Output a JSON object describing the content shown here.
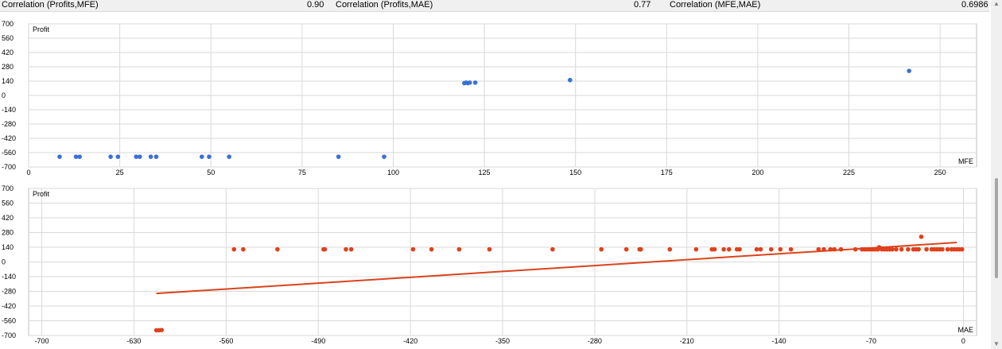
{
  "correlations": [
    {
      "label": "Correlation (Profits,MFE)",
      "value": "0.90"
    },
    {
      "label": "Correlation (Profits,MAE)",
      "value": "0.77"
    },
    {
      "label": "Correlation (MFE,MAE)",
      "value": "0.6986"
    }
  ],
  "scrollbar": {
    "up_icon": "triangle-up",
    "down_icon": "triangle-down"
  },
  "colors": {
    "mfe_points": "#3a6fd8",
    "mae_points": "#e0401a",
    "trend_line": "#d9441c",
    "grid": "#d9d9d9"
  },
  "chart_data": [
    {
      "type": "scatter",
      "ylabel": "Profit",
      "xlabel": "MFE",
      "ylim": [
        -700,
        700
      ],
      "xlim": [
        0,
        260
      ],
      "y_ticks": [
        700,
        560,
        420,
        280,
        140,
        0,
        -140,
        -280,
        -420,
        -560,
        -700
      ],
      "x_ticks": [
        0,
        25,
        50,
        75,
        100,
        125,
        150,
        175,
        200,
        225,
        250
      ],
      "grid": true,
      "points": [
        {
          "x": 8.5,
          "y": -600
        },
        {
          "x": 13,
          "y": -600
        },
        {
          "x": 14,
          "y": -600
        },
        {
          "x": 22.5,
          "y": -600
        },
        {
          "x": 24.5,
          "y": -600
        },
        {
          "x": 29.5,
          "y": -600
        },
        {
          "x": 30.5,
          "y": -600
        },
        {
          "x": 33.5,
          "y": -600
        },
        {
          "x": 35,
          "y": -600
        },
        {
          "x": 47.5,
          "y": -600
        },
        {
          "x": 49.5,
          "y": -600
        },
        {
          "x": 55,
          "y": -600
        },
        {
          "x": 85,
          "y": -600
        },
        {
          "x": 97.5,
          "y": -600
        },
        {
          "x": 119.5,
          "y": 120
        },
        {
          "x": 120,
          "y": 125
        },
        {
          "x": 120.5,
          "y": 120
        },
        {
          "x": 121,
          "y": 125
        },
        {
          "x": 122.5,
          "y": 125
        },
        {
          "x": 148.5,
          "y": 150
        },
        {
          "x": 241.5,
          "y": 240
        }
      ]
    },
    {
      "type": "scatter",
      "ylabel": "Profit",
      "xlabel": "MAE",
      "ylim": [
        -700,
        700
      ],
      "xlim": [
        -710,
        10
      ],
      "y_ticks": [
        700,
        560,
        420,
        280,
        140,
        0,
        -140,
        -280,
        -420,
        -560,
        -700
      ],
      "x_ticks": [
        -700,
        -630,
        -560,
        -490,
        -420,
        -350,
        -280,
        -210,
        -140,
        -70,
        0
      ],
      "grid": true,
      "trend_line": [
        {
          "x": -613,
          "y": -300
        },
        {
          "x": -5,
          "y": 185
        }
      ],
      "points": [
        {
          "x": -613,
          "y": -650
        },
        {
          "x": -611,
          "y": -650
        },
        {
          "x": -609,
          "y": -648
        },
        {
          "x": -554,
          "y": 120
        },
        {
          "x": -547,
          "y": 120
        },
        {
          "x": -521,
          "y": 120
        },
        {
          "x": -486,
          "y": 120
        },
        {
          "x": -485,
          "y": 120
        },
        {
          "x": -469,
          "y": 120
        },
        {
          "x": -465,
          "y": 120
        },
        {
          "x": -418,
          "y": 120
        },
        {
          "x": -404,
          "y": 120
        },
        {
          "x": -383,
          "y": 120
        },
        {
          "x": -360,
          "y": 120
        },
        {
          "x": -312,
          "y": 120
        },
        {
          "x": -275,
          "y": 120
        },
        {
          "x": -256,
          "y": 120
        },
        {
          "x": -246,
          "y": 120
        },
        {
          "x": -245,
          "y": 120
        },
        {
          "x": -223,
          "y": 120
        },
        {
          "x": -203,
          "y": 120
        },
        {
          "x": -191,
          "y": 120
        },
        {
          "x": -189,
          "y": 120
        },
        {
          "x": -182,
          "y": 120
        },
        {
          "x": -178,
          "y": 120
        },
        {
          "x": -172,
          "y": 120
        },
        {
          "x": -170,
          "y": 120
        },
        {
          "x": -157,
          "y": 120
        },
        {
          "x": -154,
          "y": 120
        },
        {
          "x": -146,
          "y": 120
        },
        {
          "x": -139,
          "y": 120
        },
        {
          "x": -131,
          "y": 120
        },
        {
          "x": -110,
          "y": 120
        },
        {
          "x": -106,
          "y": 120
        },
        {
          "x": -101,
          "y": 120
        },
        {
          "x": -98,
          "y": 120
        },
        {
          "x": -93,
          "y": 120
        },
        {
          "x": -82,
          "y": 120
        },
        {
          "x": -77,
          "y": 120
        },
        {
          "x": -75,
          "y": 120
        },
        {
          "x": -73,
          "y": 120
        },
        {
          "x": -71,
          "y": 120
        },
        {
          "x": -69,
          "y": 120
        },
        {
          "x": -67,
          "y": 120
        },
        {
          "x": -65,
          "y": 120
        },
        {
          "x": -64,
          "y": 140
        },
        {
          "x": -62,
          "y": 120
        },
        {
          "x": -60,
          "y": 120
        },
        {
          "x": -58,
          "y": 120
        },
        {
          "x": -56,
          "y": 120
        },
        {
          "x": -54,
          "y": 120
        },
        {
          "x": -51,
          "y": 120
        },
        {
          "x": -47,
          "y": 120
        },
        {
          "x": -42,
          "y": 120
        },
        {
          "x": -38,
          "y": 120
        },
        {
          "x": -36,
          "y": 120
        },
        {
          "x": -34,
          "y": 120
        },
        {
          "x": -32,
          "y": 240
        },
        {
          "x": -28,
          "y": 120
        },
        {
          "x": -24,
          "y": 120
        },
        {
          "x": -22,
          "y": 120
        },
        {
          "x": -20,
          "y": 120
        },
        {
          "x": -18,
          "y": 120
        },
        {
          "x": -16,
          "y": 120
        },
        {
          "x": -12,
          "y": 120
        },
        {
          "x": -9,
          "y": 120
        },
        {
          "x": -7,
          "y": 120
        },
        {
          "x": -5,
          "y": 120
        },
        {
          "x": -3,
          "y": 120
        },
        {
          "x": -1,
          "y": 120
        }
      ]
    }
  ]
}
